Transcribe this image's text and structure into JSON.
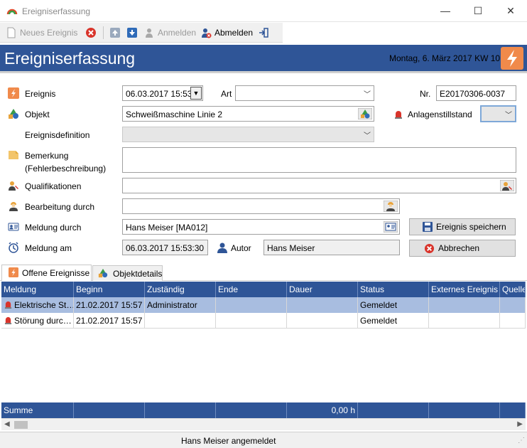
{
  "window": {
    "title": "Ereigniserfassung",
    "minimize": "—",
    "maximize": "☐",
    "close": "✕"
  },
  "toolbar": {
    "new_event": "Neues Ereignis",
    "login": "Anmelden",
    "logout": "Abmelden"
  },
  "header": {
    "title": "Ereigniserfassung",
    "date": "Montag, 6. März 2017  KW 10"
  },
  "form": {
    "ereignis_label": "Ereignis",
    "ereignis_value": "06.03.2017 15:53",
    "art_label": "Art",
    "art_value": "",
    "nr_label": "Nr.",
    "nr_value": "E20170306-0037",
    "objekt_label": "Objekt",
    "objekt_value": "Schweißmaschine Linie 2",
    "anlagenstillstand_label": "Anlagenstillstand",
    "anlagenstillstand_value": "",
    "ereignisdefinition_label": "Ereignisdefinition",
    "ereignisdefinition_value": "",
    "bemerkung_label": "Bemerkung",
    "bemerkung_sublabel": "(Fehlerbeschreibung)",
    "bemerkung_value": "",
    "qualifikationen_label": "Qualifikationen",
    "qualifikationen_value": "",
    "bearbeitung_label": "Bearbeitung durch",
    "bearbeitung_value": "",
    "meldung_durch_label": "Meldung durch",
    "meldung_durch_value": "Hans Meiser [MA012]",
    "meldung_am_label": "Meldung am",
    "meldung_am_value": "06.03.2017 15:53:30",
    "autor_label": "Autor",
    "autor_value": "Hans Meiser",
    "save_button": "Ereignis speichern",
    "cancel_button": "Abbrechen"
  },
  "tabs": [
    {
      "label": "Offene Ereignisse",
      "active": true
    },
    {
      "label": "Objektdetails",
      "active": false
    }
  ],
  "grid": {
    "columns": [
      "Meldung",
      "Beginn",
      "Zuständig",
      "Ende",
      "Dauer",
      "Status",
      "Externes Ereignis",
      "Quelle"
    ],
    "rows": [
      [
        "Elektrische St…",
        "21.02.2017 15:57",
        "Administrator",
        "",
        "",
        "Gemeldet",
        "",
        ""
      ],
      [
        "Störung durc…",
        "21.02.2017 15:57",
        "",
        "",
        "",
        "Gemeldet",
        "",
        ""
      ]
    ],
    "summary_label": "Summe",
    "summary_dauer": "0,00 h"
  },
  "status": {
    "text": "Hans Meiser angemeldet"
  },
  "colors": {
    "header_blue": "#2f5597",
    "selection": "#a8bde0",
    "accent_orange": "#f08a4b"
  }
}
